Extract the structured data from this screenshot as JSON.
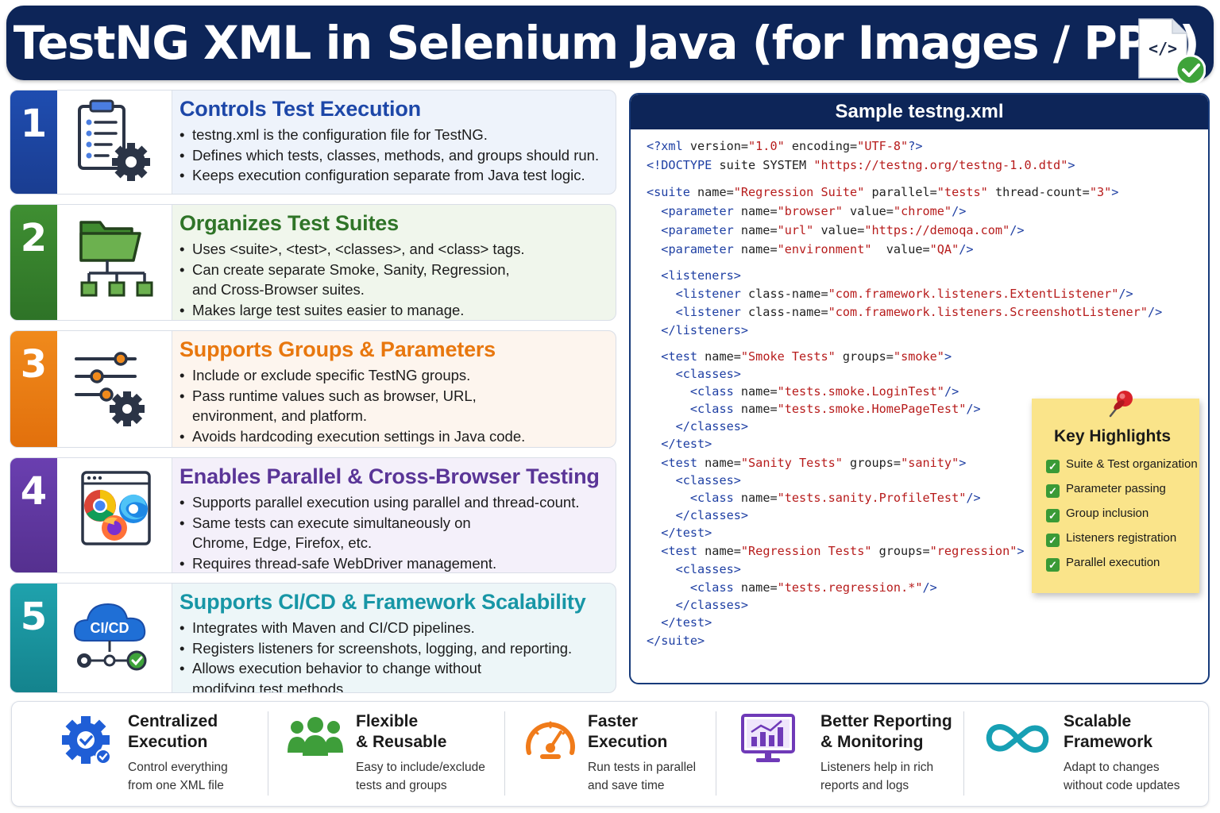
{
  "header": {
    "title": "TestNG XML in Selenium Java (for Images / PPT)",
    "badge_code": "</>"
  },
  "features": [
    {
      "number": "1",
      "title": "Controls Test Execution",
      "bullets": [
        "testng.xml is the configuration file for TestNG.",
        "Defines which tests, classes, methods, and groups should run.",
        "Keeps execution configuration separate from Java test logic."
      ]
    },
    {
      "number": "2",
      "title": "Organizes Test Suites",
      "bullets": [
        "Uses <suite>, <test>, <classes>, and <class> tags.",
        "Can create separate Smoke, Sanity, Regression,",
        "and Cross-Browser suites.",
        "Makes large test suites easier to manage."
      ]
    },
    {
      "number": "3",
      "title": "Supports Groups & Parameters",
      "bullets": [
        "Include or exclude specific TestNG groups.",
        "Pass runtime values such as browser, URL,",
        "environment, and platform.",
        "Avoids hardcoding execution settings in Java code."
      ]
    },
    {
      "number": "4",
      "title": "Enables Parallel & Cross-Browser Testing",
      "bullets": [
        "Supports parallel execution using parallel and thread-count.",
        "Same tests can execute simultaneously on",
        "Chrome, Edge, Firefox, etc.",
        "Requires thread-safe WebDriver management."
      ]
    },
    {
      "number": "5",
      "title": "Supports CI/CD & Framework Scalability",
      "icon_label": "CI/CD",
      "bullets": [
        "Integrates with Maven and CI/CD pipelines.",
        "Registers listeners for screenshots, logging, and reporting.",
        "Allows execution behavior to change without",
        "modifying test methods."
      ]
    }
  ],
  "code_panel": {
    "title": "Sample testng.xml",
    "lines": [
      "<?xml version=\"1.0\" encoding=\"UTF-8\"?>",
      "<!DOCTYPE suite SYSTEM \"https://testng.org/testng-1.0.dtd\">",
      "<suite name=\"Regression Suite\" parallel=\"tests\" thread-count=\"3\">",
      "  <parameter name=\"browser\" value=\"chrome\"/>",
      "  <parameter name=\"url\" value=\"https://demoqa.com\"/>",
      "  <parameter name=\"environment\"  value=\"QA\"/>",
      "  <listeners>",
      "    <listener class-name=\"com.framework.listeners.ExtentListener\"/>",
      "    <listener class-name=\"com.framework.listeners.ScreenshotListener\"/>",
      "  </listeners>",
      "  <test name=\"Smoke Tests\" groups=\"smoke\">",
      "    <classes>",
      "      <class name=\"tests.smoke.LoginTest\"/>",
      "      <class name=\"tests.smoke.HomePageTest\"/>",
      "    </classes>",
      "  </test>",
      "  <test name=\"Sanity Tests\" groups=\"sanity\">",
      "    <classes>",
      "      <class name=\"tests.sanity.ProfileTest\"/>",
      "    </classes>",
      "  </test>",
      "  <test name=\"Regression Tests\" groups=\"regression\">",
      "    <classes>",
      "      <class name=\"tests.regression.*\"/>",
      "    </classes>",
      "  </test>",
      "</suite>"
    ]
  },
  "highlights": {
    "title": "Key Highlights",
    "items": [
      "Suite & Test organization",
      "Parameter passing",
      "Group inclusion",
      "Listeners registration",
      "Parallel execution"
    ]
  },
  "benefits": [
    {
      "title_1": "Centralized",
      "title_2": "Execution",
      "desc_1": "Control everything",
      "desc_2": "from one XML file",
      "icon": "gear-check-icon"
    },
    {
      "title_1": "Flexible",
      "title_2": "& Reusable",
      "desc_1": "Easy to include/exclude",
      "desc_2": "tests and groups",
      "icon": "people-icon"
    },
    {
      "title_1": "Faster",
      "title_2": "Execution",
      "desc_1": "Run tests in parallel",
      "desc_2": "and save time",
      "icon": "speedometer-icon"
    },
    {
      "title_1": "Better Reporting",
      "title_2": "& Monitoring",
      "desc_1": "Listeners help in rich",
      "desc_2": "reports and logs",
      "icon": "chart-monitor-icon"
    },
    {
      "title_1": "Scalable",
      "title_2": "Framework",
      "desc_1": "Adapt to changes",
      "desc_2": "without code updates",
      "icon": "infinity-icon"
    }
  ],
  "colors": {
    "navy": "#0d2558",
    "blue": "#1d47a8",
    "green": "#2f7428",
    "orange": "#e8770e",
    "purple": "#5a3597",
    "teal": "#1796a6",
    "note_yellow": "#fae48a"
  }
}
